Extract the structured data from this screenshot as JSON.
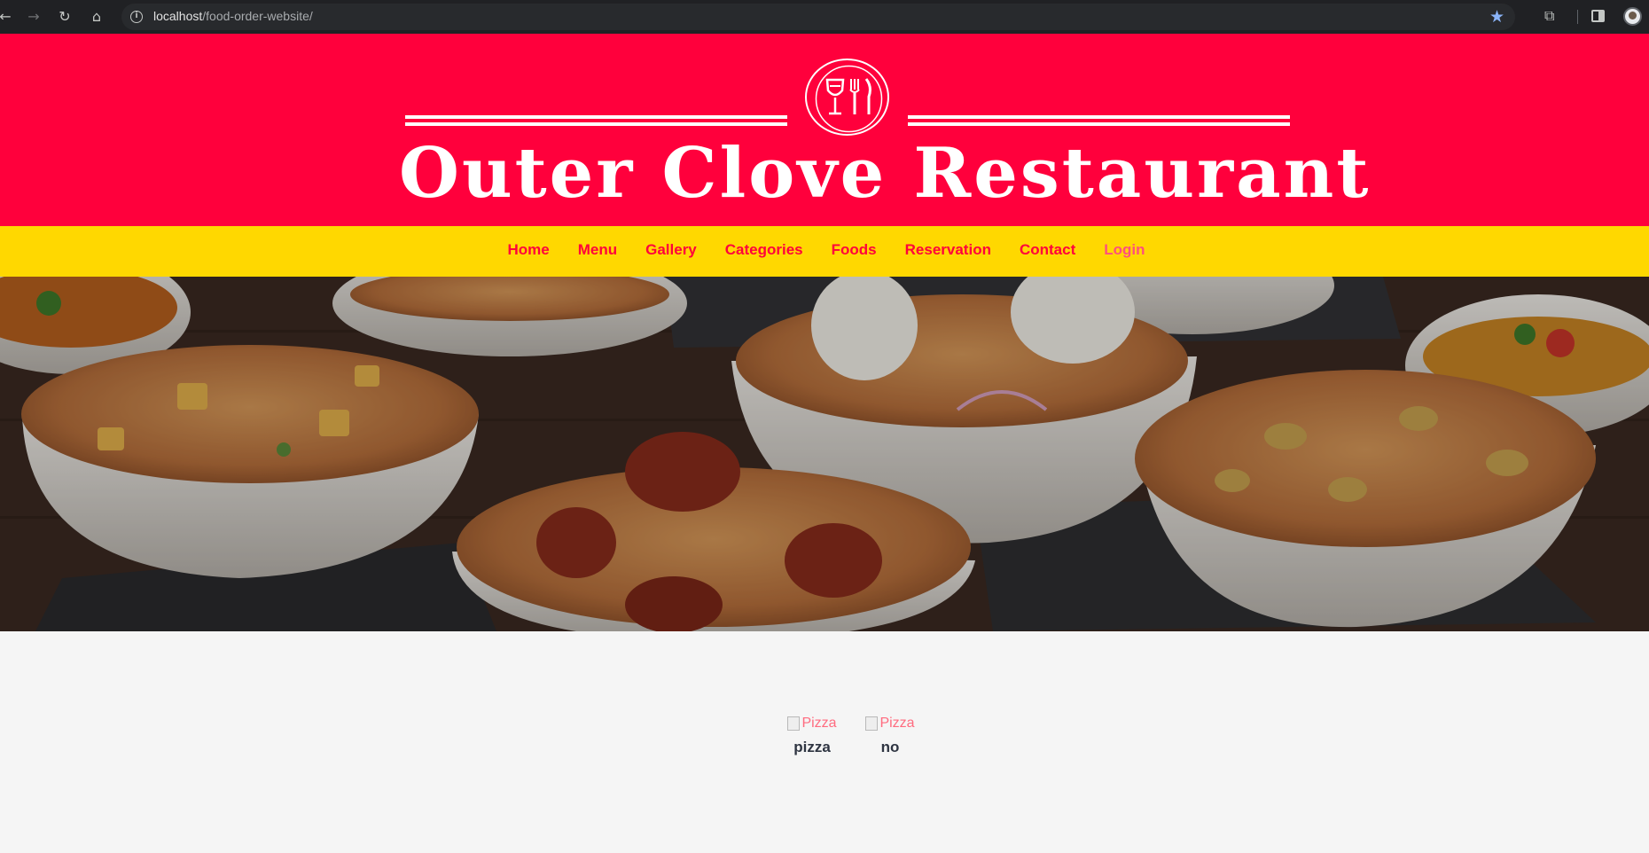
{
  "browser": {
    "url_host": "localhost",
    "url_path": "/food-order-website/"
  },
  "header": {
    "brand": "Outer Clove Restaurant"
  },
  "nav": {
    "items": [
      "Home",
      "Menu",
      "Gallery",
      "Categories",
      "Foods",
      "Reservation",
      "Contact"
    ],
    "login": "Login"
  },
  "categories": [
    {
      "img_alt": "Pizza",
      "name": "pizza"
    },
    {
      "img_alt": "Pizza",
      "name": "no"
    }
  ],
  "colors": {
    "banner": "#ff003c",
    "nav_bg": "#ffd800",
    "nav_text": "#ff003c"
  }
}
